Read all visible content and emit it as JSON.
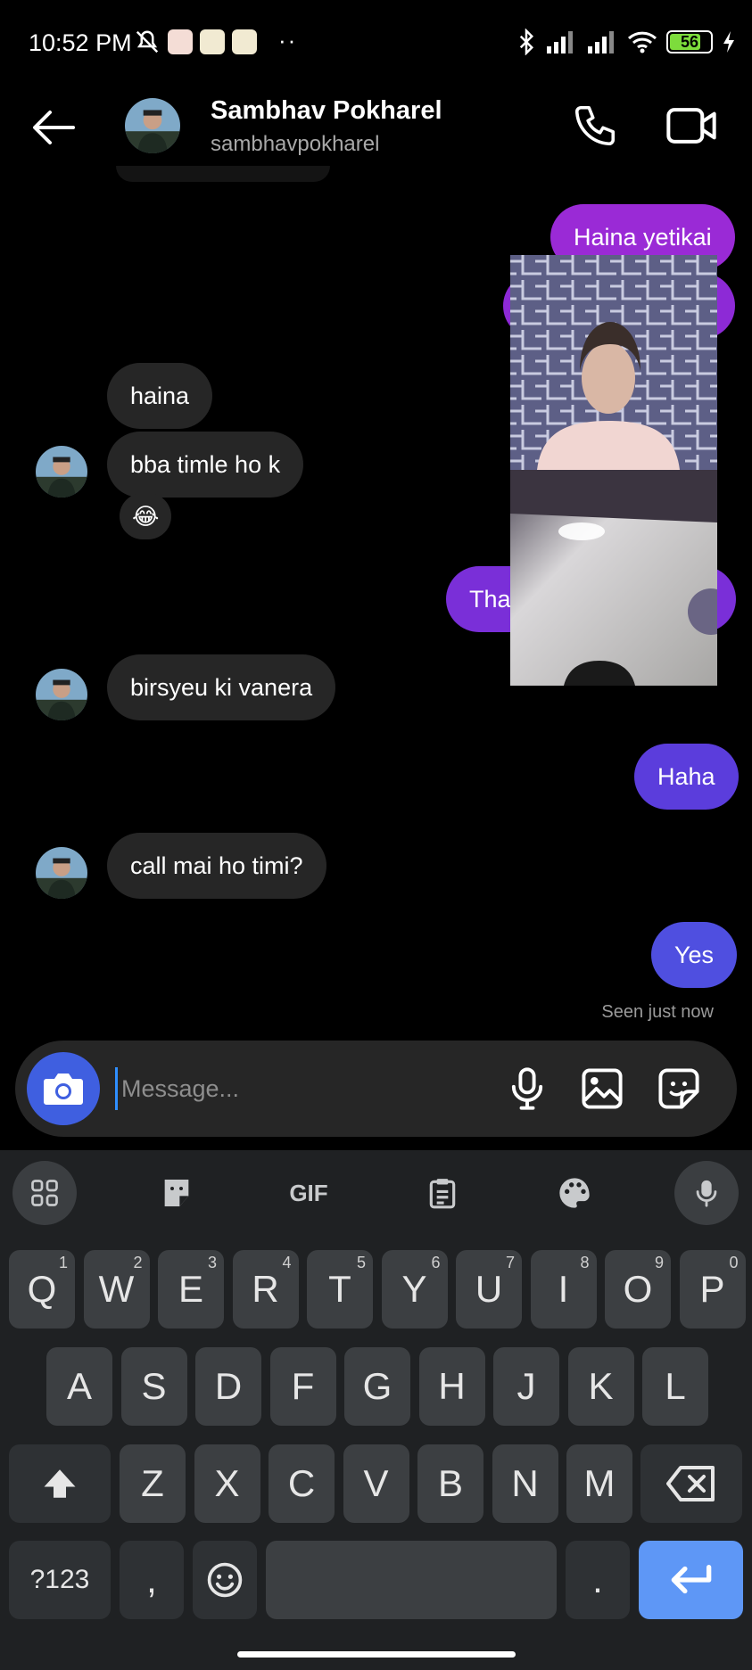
{
  "status_bar": {
    "time": "10:52 PM",
    "dots": "··",
    "battery": "56"
  },
  "header": {
    "name": "Sambhav Pokharel",
    "username": "sambhavpokharel"
  },
  "messages": [
    {
      "from": "me",
      "text": "Haina yetikai"
    },
    {
      "from": "them",
      "text": "haina"
    },
    {
      "from": "them",
      "text": "bba timle ho k"
    },
    {
      "from": "them",
      "text": "😂"
    },
    {
      "from": "me",
      "text": "Tha"
    },
    {
      "from": "them",
      "text": "birsyeu ki vanera"
    },
    {
      "from": "me",
      "text": "Haha"
    },
    {
      "from": "them",
      "text": "call mai ho timi?"
    },
    {
      "from": "me",
      "text": "Yes"
    }
  ],
  "seen": "Seen just now",
  "composer": {
    "placeholder": "Message..."
  },
  "keyboard": {
    "gif_label": "GIF",
    "row1": [
      {
        "k": "Q",
        "n": "1"
      },
      {
        "k": "W",
        "n": "2"
      },
      {
        "k": "E",
        "n": "3"
      },
      {
        "k": "R",
        "n": "4"
      },
      {
        "k": "T",
        "n": "5"
      },
      {
        "k": "Y",
        "n": "6"
      },
      {
        "k": "U",
        "n": "7"
      },
      {
        "k": "I",
        "n": "8"
      },
      {
        "k": "O",
        "n": "9"
      },
      {
        "k": "P",
        "n": "0"
      }
    ],
    "row2": [
      "A",
      "S",
      "D",
      "F",
      "G",
      "H",
      "J",
      "K",
      "L"
    ],
    "row3": [
      "Z",
      "X",
      "C",
      "V",
      "B",
      "N",
      "M"
    ],
    "symbols_label": "?123",
    "comma": ",",
    "period": "."
  },
  "colors": {
    "bubble_out_top": "#9a2ad6",
    "bubble_out_mid": "#7a2fd8",
    "bubble_out_bottom": "#4f4fe0",
    "bubble_in": "#262626",
    "camera_button": "#3f5fe0",
    "enter_key": "#5e97f6"
  }
}
